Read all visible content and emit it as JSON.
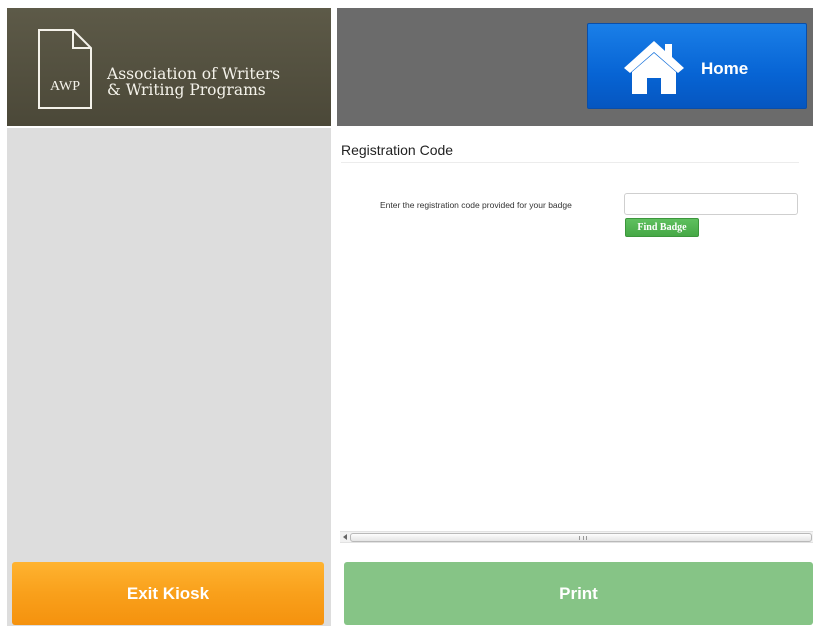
{
  "header": {
    "logo_abbr": "AWP",
    "logo_name_line1": "Association of Writers",
    "logo_name_line2": "& Writing Programs",
    "home_label": "Home"
  },
  "main": {
    "section_title": "Registration Code",
    "code_label": "Enter the registration code provided for your badge",
    "code_input_value": "",
    "find_badge_label": "Find Badge"
  },
  "footer": {
    "exit_label": "Exit Kiosk",
    "print_label": "Print"
  },
  "icons": {
    "logo": "document-icon",
    "home": "house-icon"
  },
  "colors": {
    "header_dark": "#4f4c3c",
    "header_grey": "#6b6b6b",
    "home_blue": "#0764d4",
    "find_badge_green": "#4cb04c",
    "exit_orange": "#f9a01b",
    "print_green": "#86c486",
    "panel_grey": "#dddddd"
  }
}
